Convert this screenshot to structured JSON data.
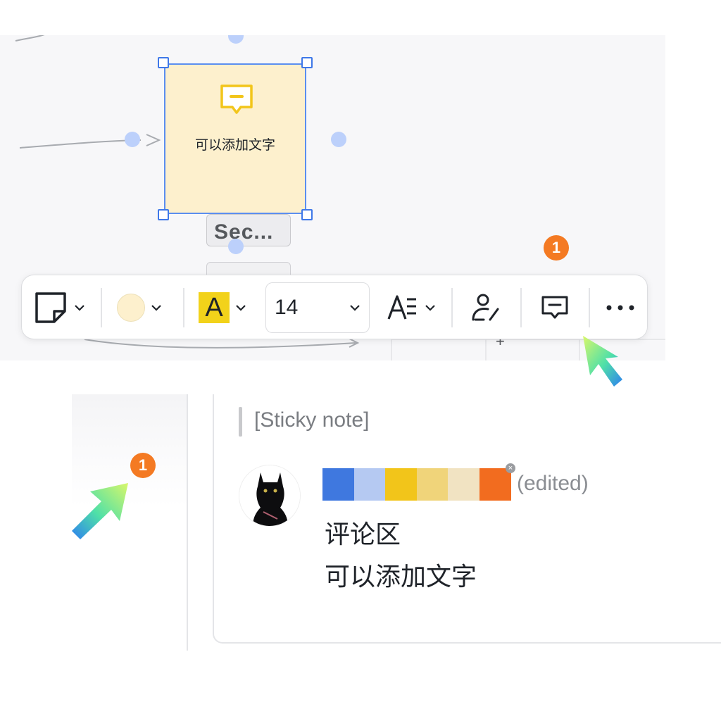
{
  "canvas": {
    "sticky_note_text": "可以添加文字",
    "section_label": "Sec...",
    "note_color": "#fdf0cd",
    "selection_color": "#3f78e8"
  },
  "toolbar": {
    "shape_icon": "sticky-note-icon",
    "fill_color": "#fdf0cd",
    "text_color_glyph": "A",
    "text_color": "#f2d21a",
    "font_size": "14",
    "text_style_icon": "text-align-icon",
    "assign_icon": "person-edit-icon",
    "comment_icon": "comment-icon",
    "more_icon": "more-horizontal-icon"
  },
  "badges": {
    "toolbar_count": "1",
    "sidebar_count": "1",
    "color": "#f47a23"
  },
  "comment": {
    "quote": "[Sticky note]",
    "name_colors": [
      "#3f78df",
      "#b5c9f2",
      "#f2c51a",
      "#f0d47a",
      "#f1e3c2",
      "#f26c1f"
    ],
    "edited_label": "(edited)",
    "lines": [
      "评论区",
      "可以添加文字"
    ]
  }
}
